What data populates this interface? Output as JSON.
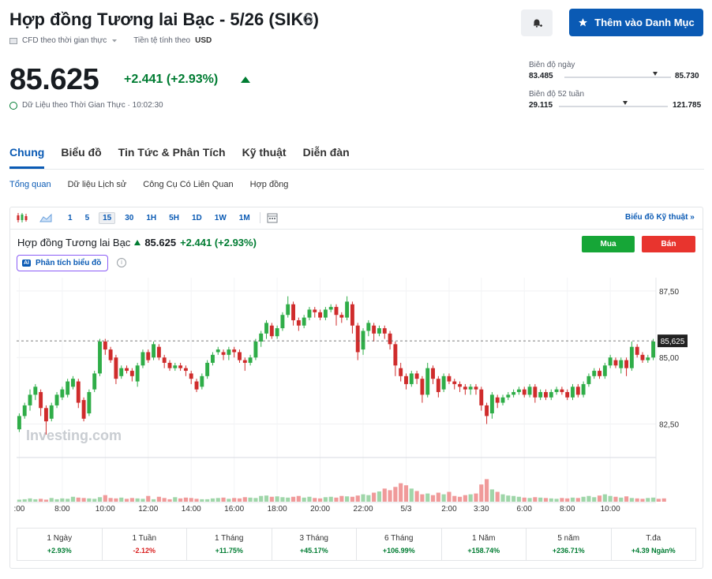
{
  "header": {
    "title": "Hợp đồng Tương lai Bạc - 5/26 (SIK6)",
    "watchlist_label": "Thêm vào Danh Mục",
    "cfd_label": "CFD theo thời gian thực",
    "currency_label": "Tiền tệ tính theo",
    "currency": "USD",
    "price": "85.625",
    "change": "+2.441 (+2.93%)",
    "realtime_label": "Dữ Liệu theo Thời Gian Thực · 10:02:30"
  },
  "ranges": {
    "day": {
      "label": "Biên độ ngày",
      "low": "83.485",
      "high": "85.730",
      "position": 0.85
    },
    "week52": {
      "label": "Biên độ 52 tuần",
      "low": "29.115",
      "high": "121.785",
      "position": 0.61
    }
  },
  "tabs": [
    "Chung",
    "Biểu đồ",
    "Tin Tức & Phân Tích",
    "Kỹ thuật",
    "Diễn đàn"
  ],
  "subtabs": [
    "Tổng quan",
    "Dữ liệu Lịch sử",
    "Công Cụ Có Liên Quan",
    "Hợp đồng"
  ],
  "toolbar": {
    "timeframes": [
      "1",
      "5",
      "15",
      "30",
      "1H",
      "5H",
      "1D",
      "1W",
      "1M"
    ],
    "selected": "15",
    "tech_link": "Biểu đồ Kỹ thuật »"
  },
  "legend": {
    "symbol": "Hợp đồng Tương lai Bạc",
    "price": "85.625",
    "change": "+2.441 (+2.93%)",
    "buy": "Mua",
    "sell": "Bán",
    "ai_label": "Phân tích biểu đồ",
    "ai_badge": "AI"
  },
  "chart_data": {
    "type": "candlestick",
    "watermark": "Investing.com",
    "ylim": [
      81.3,
      88.0
    ],
    "y_ticks": [
      "87,50",
      "85,00",
      "82,50"
    ],
    "y_tick_values": [
      87.5,
      85.0,
      82.5
    ],
    "last_price_label": "85,625",
    "last_price": 85.625,
    "x_tick_labels": [
      ":00",
      "8:00",
      "10:00",
      "12:00",
      "14:00",
      "16:00",
      "18:00",
      "20:00",
      "22:00",
      "5/3",
      "2:00",
      "3:30",
      "6:00",
      "8:00",
      "10:00"
    ],
    "x_tick_index": [
      0,
      8,
      16,
      24,
      32,
      40,
      48,
      56,
      64,
      72,
      80,
      86,
      94,
      102,
      110
    ],
    "candles": [
      [
        82.3,
        82.8,
        82.2,
        82.9
      ],
      [
        82.8,
        83.2,
        82.7,
        83.3
      ],
      [
        83.2,
        83.6,
        83.0,
        83.8
      ],
      [
        83.6,
        83.9,
        83.4,
        84.0
      ],
      [
        83.7,
        83.1,
        82.8,
        83.8
      ],
      [
        83.1,
        82.6,
        82.1,
        83.2
      ],
      [
        82.7,
        83.2,
        82.6,
        83.3
      ],
      [
        83.2,
        83.6,
        83.1,
        83.7
      ],
      [
        83.5,
        83.8,
        83.4,
        83.9
      ],
      [
        83.6,
        84.1,
        83.5,
        84.2
      ],
      [
        83.9,
        84.2,
        83.8,
        84.3
      ],
      [
        84.1,
        83.3,
        83.1,
        84.2
      ],
      [
        83.4,
        82.7,
        82.6,
        83.5
      ],
      [
        82.9,
        83.7,
        82.8,
        83.8
      ],
      [
        83.8,
        84.4,
        83.7,
        84.5
      ],
      [
        84.4,
        85.6,
        84.3,
        85.7
      ],
      [
        85.6,
        85.3,
        85.1,
        85.7
      ],
      [
        85.3,
        84.9,
        84.8,
        85.4
      ],
      [
        85.0,
        84.2,
        84.0,
        85.1
      ],
      [
        84.3,
        84.6,
        84.2,
        84.7
      ],
      [
        84.6,
        84.5,
        84.4,
        84.7
      ],
      [
        84.5,
        84.3,
        84.1,
        84.6
      ],
      [
        84.1,
        84.7,
        83.9,
        84.8
      ],
      [
        84.7,
        85.2,
        84.6,
        85.3
      ],
      [
        85.2,
        84.9,
        84.8,
        85.3
      ],
      [
        85.0,
        85.5,
        84.9,
        85.6
      ],
      [
        85.4,
        85.0,
        84.9,
        85.5
      ],
      [
        85.0,
        84.8,
        84.6,
        85.1
      ],
      [
        84.8,
        84.6,
        84.5,
        84.9
      ],
      [
        84.6,
        84.7,
        84.5,
        84.8
      ],
      [
        84.7,
        84.6,
        84.5,
        84.8
      ],
      [
        84.6,
        84.5,
        84.3,
        84.7
      ],
      [
        84.4,
        84.2,
        84.0,
        84.5
      ],
      [
        84.1,
        83.8,
        83.7,
        84.2
      ],
      [
        83.9,
        84.3,
        83.8,
        84.4
      ],
      [
        84.3,
        84.8,
        84.2,
        84.9
      ],
      [
        84.8,
        85.1,
        84.7,
        85.2
      ],
      [
        85.2,
        85.3,
        85.1,
        85.4
      ],
      [
        85.2,
        85.1,
        84.9,
        85.3
      ],
      [
        85.1,
        85.3,
        84.9,
        85.4
      ],
      [
        85.3,
        85.2,
        85.0,
        85.4
      ],
      [
        85.2,
        84.9,
        84.8,
        85.3
      ],
      [
        84.9,
        84.8,
        84.5,
        85.0
      ],
      [
        84.8,
        85.0,
        84.7,
        85.1
      ],
      [
        85.0,
        85.6,
        84.9,
        85.7
      ],
      [
        85.6,
        85.9,
        85.4,
        86.0
      ],
      [
        85.9,
        86.3,
        85.7,
        86.4
      ],
      [
        86.2,
        85.8,
        85.7,
        86.3
      ],
      [
        85.8,
        86.1,
        85.7,
        86.2
      ],
      [
        86.1,
        86.6,
        86.0,
        86.7
      ],
      [
        86.6,
        87.0,
        86.5,
        87.3
      ],
      [
        87.0,
        86.4,
        86.2,
        87.1
      ],
      [
        86.4,
        86.2,
        86.0,
        86.5
      ],
      [
        86.2,
        86.5,
        86.1,
        86.6
      ],
      [
        86.5,
        86.8,
        86.4,
        86.9
      ],
      [
        86.8,
        86.7,
        86.5,
        86.9
      ],
      [
        86.7,
        86.5,
        86.4,
        86.8
      ],
      [
        86.5,
        86.8,
        86.4,
        86.9
      ],
      [
        86.8,
        86.9,
        86.7,
        87.0
      ],
      [
        86.9,
        86.6,
        86.2,
        87.0
      ],
      [
        86.6,
        86.5,
        86.3,
        86.7
      ],
      [
        86.5,
        87.1,
        86.4,
        87.3
      ],
      [
        87.0,
        86.2,
        85.9,
        87.1
      ],
      [
        86.2,
        85.2,
        84.9,
        86.3
      ],
      [
        85.3,
        86.0,
        85.1,
        86.1
      ],
      [
        86.0,
        86.3,
        85.8,
        86.4
      ],
      [
        86.2,
        85.9,
        85.6,
        86.3
      ],
      [
        85.9,
        86.1,
        85.8,
        86.2
      ],
      [
        86.1,
        85.9,
        85.7,
        86.2
      ],
      [
        85.9,
        85.5,
        85.3,
        86.0
      ],
      [
        85.5,
        84.7,
        84.3,
        85.6
      ],
      [
        84.6,
        84.3,
        84.1,
        84.8
      ],
      [
        84.3,
        84.0,
        83.8,
        84.4
      ],
      [
        84.0,
        84.4,
        83.9,
        84.5
      ],
      [
        84.4,
        84.2,
        84.0,
        84.5
      ],
      [
        84.2,
        83.6,
        83.3,
        84.3
      ],
      [
        83.6,
        84.6,
        83.5,
        84.8
      ],
      [
        84.6,
        84.2,
        84.0,
        84.7
      ],
      [
        84.2,
        83.7,
        83.5,
        84.3
      ],
      [
        83.8,
        84.3,
        83.7,
        84.4
      ],
      [
        84.3,
        84.1,
        84.0,
        84.4
      ],
      [
        84.1,
        84.0,
        83.8,
        84.2
      ],
      [
        84.0,
        83.9,
        83.7,
        84.1
      ],
      [
        83.9,
        83.8,
        83.6,
        84.0
      ],
      [
        83.8,
        83.9,
        83.6,
        84.0
      ],
      [
        83.9,
        83.8,
        83.6,
        84.0
      ],
      [
        83.8,
        83.2,
        83.0,
        83.9
      ],
      [
        83.2,
        82.8,
        82.5,
        83.3
      ],
      [
        82.9,
        83.6,
        82.7,
        83.7
      ],
      [
        83.5,
        83.3,
        83.1,
        83.6
      ],
      [
        83.3,
        83.5,
        83.2,
        83.6
      ],
      [
        83.5,
        83.6,
        83.4,
        83.7
      ],
      [
        83.6,
        83.7,
        83.5,
        83.8
      ],
      [
        83.7,
        83.8,
        83.6,
        83.9
      ],
      [
        83.8,
        83.6,
        83.5,
        83.9
      ],
      [
        83.6,
        83.9,
        83.5,
        84.0
      ],
      [
        83.9,
        83.5,
        83.3,
        84.0
      ],
      [
        83.5,
        83.7,
        83.4,
        83.8
      ],
      [
        83.7,
        83.5,
        83.4,
        83.8
      ],
      [
        83.5,
        83.7,
        83.4,
        83.8
      ],
      [
        83.7,
        83.8,
        83.6,
        83.9
      ],
      [
        83.8,
        83.7,
        83.6,
        83.9
      ],
      [
        83.7,
        83.5,
        83.4,
        83.8
      ],
      [
        83.5,
        83.9,
        83.4,
        84.0
      ],
      [
        83.9,
        83.6,
        83.5,
        84.0
      ],
      [
        83.6,
        84.0,
        83.5,
        84.1
      ],
      [
        84.0,
        84.3,
        83.9,
        84.4
      ],
      [
        84.3,
        84.5,
        84.2,
        84.6
      ],
      [
        84.5,
        84.3,
        84.2,
        84.6
      ],
      [
        84.3,
        84.7,
        84.2,
        84.8
      ],
      [
        84.7,
        85.0,
        84.6,
        85.1
      ],
      [
        84.9,
        84.7,
        84.6,
        85.0
      ],
      [
        84.6,
        84.9,
        84.4,
        85.0
      ],
      [
        84.9,
        84.6,
        84.3,
        85.0
      ],
      [
        84.6,
        85.4,
        84.5,
        85.6
      ],
      [
        85.4,
        85.1,
        85.0,
        85.5
      ],
      [
        85.1,
        84.9,
        84.8,
        85.2
      ],
      [
        84.9,
        85.0,
        84.8,
        85.1
      ],
      [
        85.0,
        85.6,
        84.9,
        85.7
      ]
    ],
    "volume_max": 100,
    "volume": [
      5,
      6,
      8,
      6,
      7,
      5,
      9,
      6,
      8,
      7,
      12,
      10,
      9,
      8,
      7,
      11,
      16,
      9,
      8,
      10,
      7,
      9,
      8,
      7,
      14,
      6,
      12,
      9,
      6,
      11,
      8,
      10,
      9,
      7,
      6,
      6,
      8,
      9,
      10,
      7,
      9,
      8,
      11,
      10,
      9,
      14,
      15,
      12,
      13,
      11,
      10,
      12,
      14,
      10,
      12,
      9,
      8,
      11,
      12,
      10,
      14,
      13,
      12,
      15,
      18,
      16,
      22,
      25,
      32,
      28,
      36,
      45,
      40,
      32,
      26,
      18,
      20,
      16,
      22,
      18,
      24,
      14,
      12,
      16,
      18,
      20,
      42,
      55,
      30,
      24,
      18,
      15,
      14,
      12,
      10,
      9,
      11,
      10,
      9,
      8,
      7,
      9,
      8,
      10,
      9,
      12,
      14,
      11,
      15,
      18,
      14,
      12,
      10,
      13,
      9,
      8,
      7,
      9,
      10,
      7,
      8
    ]
  },
  "performance": [
    {
      "label": "1 Ngày",
      "value": "+2.93%",
      "color": "#007c32"
    },
    {
      "label": "1 Tuần",
      "value": "-2.12%",
      "color": "#d91e1e"
    },
    {
      "label": "1 Tháng",
      "value": "+11.75%",
      "color": "#007c32"
    },
    {
      "label": "3 Tháng",
      "value": "+45.17%",
      "color": "#007c32"
    },
    {
      "label": "6 Tháng",
      "value": "+106.99%",
      "color": "#007c32"
    },
    {
      "label": "1 Năm",
      "value": "+158.74%",
      "color": "#007c32"
    },
    {
      "label": "5 năm",
      "value": "+236.71%",
      "color": "#007c32"
    },
    {
      "label": "T.đa",
      "value": "+4.39 Ngàn%",
      "color": "#007c32"
    }
  ],
  "colors": {
    "up": "#2fad48",
    "down": "#cf2c2c",
    "vol_up": "#9fd6a9",
    "vol_down": "#f09a9a",
    "accent": "#0a5ab4"
  }
}
